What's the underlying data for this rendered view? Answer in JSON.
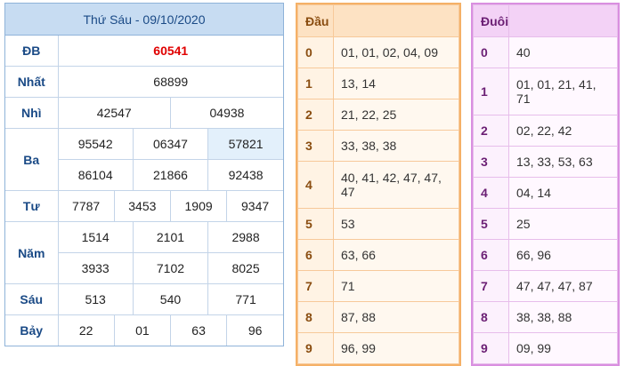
{
  "results": {
    "title": "Thứ Sáu - 09/10/2020",
    "db": {
      "label": "ĐB",
      "value": "60541"
    },
    "nhat": {
      "label": "Nhất",
      "value": "68899"
    },
    "nhi": {
      "label": "Nhì",
      "values": [
        "42547",
        "04938"
      ]
    },
    "ba": {
      "label": "Ba",
      "values": [
        "95542",
        "06347",
        "57821",
        "86104",
        "21866",
        "92438"
      ]
    },
    "tu": {
      "label": "Tư",
      "values": [
        "7787",
        "3453",
        "1909",
        "9347"
      ]
    },
    "nam": {
      "label": "Năm",
      "values": [
        "1514",
        "2101",
        "2988",
        "3933",
        "7102",
        "8025"
      ]
    },
    "sau": {
      "label": "Sáu",
      "values": [
        "513",
        "540",
        "771"
      ]
    },
    "bay": {
      "label": "Bảy",
      "values": [
        "22",
        "01",
        "63",
        "96"
      ]
    }
  },
  "dau": {
    "header": "Đầu",
    "rows": [
      {
        "k": "0",
        "v": "01, 01, 02, 04, 09"
      },
      {
        "k": "1",
        "v": "13, 14"
      },
      {
        "k": "2",
        "v": "21, 22, 25"
      },
      {
        "k": "3",
        "v": "33, 38, 38"
      },
      {
        "k": "4",
        "v": "40, 41, 42, 47, 47, 47"
      },
      {
        "k": "5",
        "v": "53"
      },
      {
        "k": "6",
        "v": "63, 66"
      },
      {
        "k": "7",
        "v": "71"
      },
      {
        "k": "8",
        "v": "87, 88"
      },
      {
        "k": "9",
        "v": "96, 99"
      }
    ]
  },
  "duoi": {
    "header": "Đuôi",
    "rows": [
      {
        "k": "0",
        "v": "40"
      },
      {
        "k": "1",
        "v": "01, 01, 21, 41, 71"
      },
      {
        "k": "2",
        "v": "02, 22, 42"
      },
      {
        "k": "3",
        "v": "13, 33, 53, 63"
      },
      {
        "k": "4",
        "v": "04, 14"
      },
      {
        "k": "5",
        "v": "25"
      },
      {
        "k": "6",
        "v": "66, 96"
      },
      {
        "k": "7",
        "v": "47, 47, 47, 87"
      },
      {
        "k": "8",
        "v": "38, 38, 88"
      },
      {
        "k": "9",
        "v": "09, 99"
      }
    ]
  },
  "colors": {
    "special_prize": "#e00000",
    "results_header": "#c7dcf2",
    "dau_accent": "#f5b167",
    "duoi_accent": "#d98fe0"
  }
}
